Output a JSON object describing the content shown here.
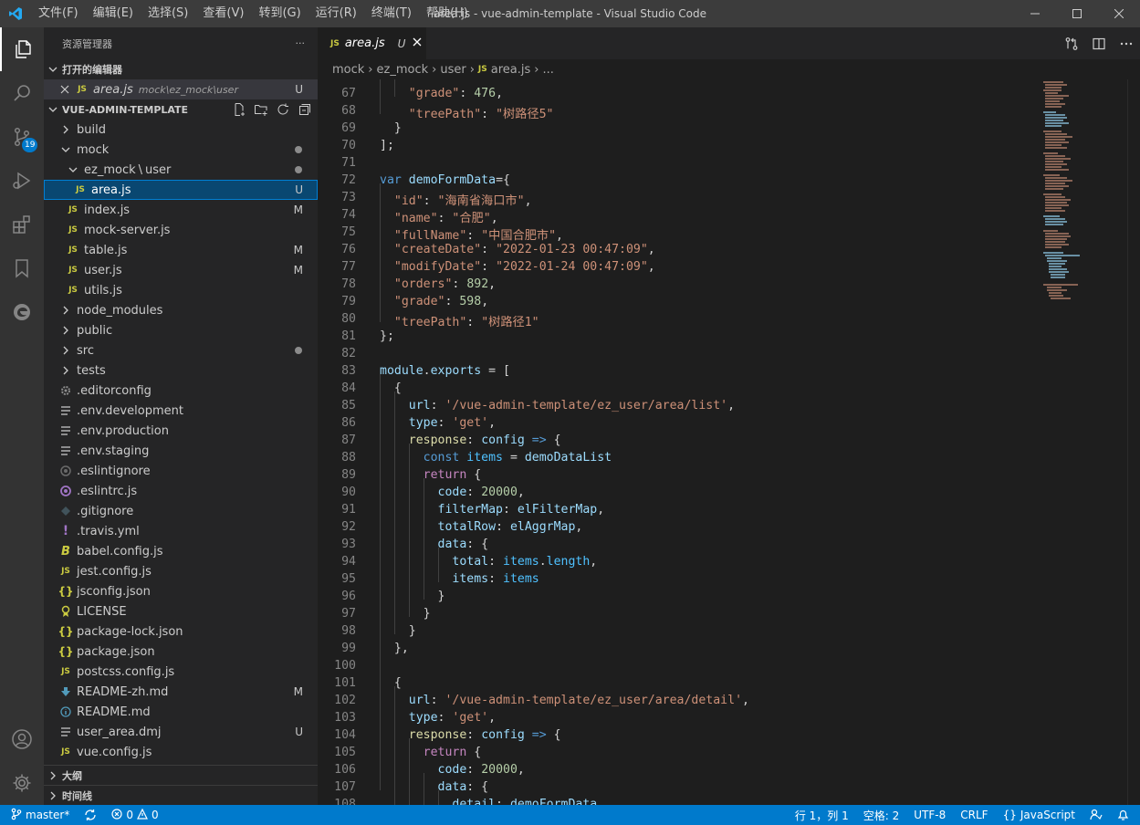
{
  "window": {
    "title": "area.js - vue-admin-template - Visual Studio Code",
    "menus": [
      "文件(F)",
      "编辑(E)",
      "选择(S)",
      "查看(V)",
      "转到(G)",
      "运行(R)",
      "终端(T)",
      "帮助(H)"
    ]
  },
  "activity_bar": {
    "items": [
      "explorer-icon",
      "search-icon",
      "source-control-icon",
      "run-debug-icon",
      "extensions-icon",
      "bookmarks-icon",
      "edge-devtools-icon"
    ],
    "scm_badge": "19",
    "bottom": [
      "account-icon",
      "settings-gear-icon"
    ]
  },
  "sidebar": {
    "title": "资源管理器",
    "more": "···",
    "open_editors": {
      "header": "打开的编辑器",
      "items": [
        {
          "name": "area.js",
          "path": "mock\\ez_mock\\user",
          "status": "U"
        }
      ]
    },
    "project": {
      "header": "VUE-ADMIN-TEMPLATE",
      "folders": {
        "build": "build",
        "mock": "mock",
        "ez_mock": "ez_mock",
        "user": "user",
        "node_modules": "node_modules",
        "public": "public",
        "src": "src",
        "tests": "tests"
      },
      "files": {
        "area": "area.js",
        "index": "index.js",
        "mock_server": "mock-server.js",
        "table": "table.js",
        "user_js": "user.js",
        "utils": "utils.js",
        "editorconfig": ".editorconfig",
        "env_dev": ".env.development",
        "env_prod": ".env.production",
        "env_staging": ".env.staging",
        "eslintignore": ".eslintignore",
        "eslintrc": ".eslintrc.js",
        "gitignore": ".gitignore",
        "travis": ".travis.yml",
        "babel": "babel.config.js",
        "jest": "jest.config.js",
        "jsconfig": "jsconfig.json",
        "license": "LICENSE",
        "pkglock": "package-lock.json",
        "pkg": "package.json",
        "postcss": "postcss.config.js",
        "readme_zh": "README-zh.md",
        "readme": "README.md",
        "user_area": "user_area.dmj",
        "vue_config": "vue.config.js"
      },
      "statuses": {
        "area": "U",
        "index": "M",
        "table": "M",
        "user_js": "M",
        "readme_zh": "M",
        "user_area": "U"
      }
    },
    "outline": "大纲",
    "timeline": "时间线"
  },
  "editor": {
    "tab": {
      "name": "area.js",
      "status": "U",
      "lang_badge": "JS"
    },
    "breadcrumb": [
      "mock",
      "ez_mock",
      "user",
      "area.js",
      "..."
    ],
    "line_numbers": [
      "67",
      "68",
      "69",
      "70",
      "71",
      "72",
      "73",
      "74",
      "75",
      "76",
      "77",
      "78",
      "79",
      "80",
      "81",
      "82",
      "83",
      "84",
      "85",
      "86",
      "87",
      "88",
      "89",
      "90",
      "91",
      "92",
      "93",
      "94",
      "95",
      "96",
      "97",
      "98",
      "99",
      "100",
      "101",
      "102",
      "103",
      "104",
      "105",
      "106",
      "107",
      "108"
    ],
    "code": {
      "grade_476": "476",
      "tree_path_5": "\"树路径5\"",
      "form_var": "demoFormData",
      "id_val": "\"海南省海口市\"",
      "name_val": "\"合肥\"",
      "full_name_val": "\"中国合肥市\"",
      "create_date_val": "\"2022-01-23 00:47:09\"",
      "modify_date_val": "\"2022-01-24 00:47:09\"",
      "orders_val": "892",
      "grade_598": "598",
      "tree_path_1": "\"树路径1\"",
      "list_url": "'/vue-admin-template/ez_user/area/list'",
      "detail_url": "'/vue-admin-template/ez_user/area/detail'",
      "get": "'get'",
      "code_val": "20000",
      "list_var": "demoDataList",
      "filter_map": "elFilterMap",
      "aggr_map": "elAggrMap"
    }
  },
  "status_bar": {
    "branch": "master*",
    "errors": "0",
    "warnings": "0",
    "position": "行 1，列 1",
    "spaces": "空格: 2",
    "encoding": "UTF-8",
    "eol": "CRLF",
    "language": "JavaScript"
  },
  "colors": {
    "accent": "#007acc",
    "selection": "#094771",
    "js_icon": "#cbcb41"
  }
}
